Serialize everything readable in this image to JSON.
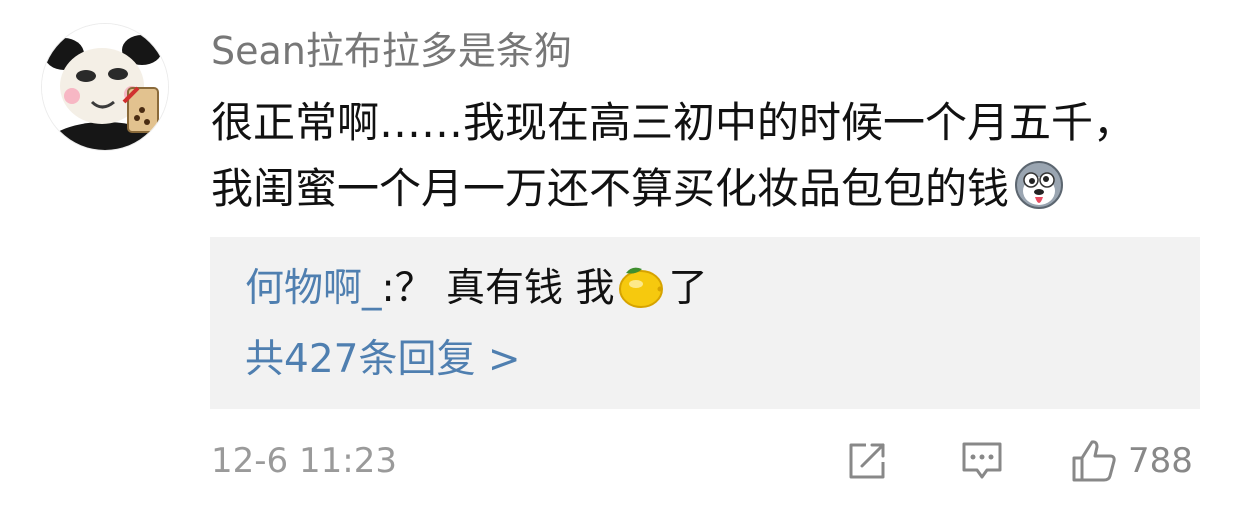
{
  "comment": {
    "username": "Sean拉布拉多是条狗",
    "text_line1": "很正常啊……我现在高三初中的时候一个月五千，",
    "text_line2": "我闺蜜一个月一万还不算买化妆品包包的钱",
    "text_emoji": "husky-face-emoji",
    "avatar": "panda-meme-avatar",
    "timestamp": "12-6 11:23",
    "like_count": "788"
  },
  "reply": {
    "user": "何物啊_",
    "text_before_emoji": ":？ 真有钱 我",
    "emoji": "lemon-emoji",
    "text_after_emoji": "了",
    "more_label": "共427条回复 >"
  },
  "colors": {
    "link": "#4f7fb0",
    "username": "#777777",
    "reply_bg": "#f2f2f2",
    "meta": "#9a9a9a"
  },
  "icons": {
    "share": "share-icon",
    "comment": "comment-icon",
    "like": "thumbs-up-icon"
  }
}
